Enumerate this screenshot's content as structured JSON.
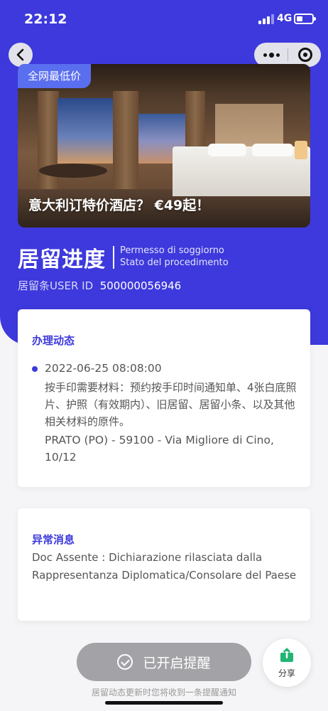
{
  "status_bar": {
    "time": "22:12",
    "network": "4G"
  },
  "nav": {
    "back_icon": "chevron-left-icon",
    "more_icon": "more-dots-icon",
    "close_icon": "target-circle-icon"
  },
  "banner": {
    "tag": "全网最低价",
    "text": "意大利订特价酒店？ €49起！"
  },
  "header": {
    "title": "居留进度",
    "subtitle_it": "Permesso di soggiorno",
    "subtitle_status": "Stato del procedimento",
    "user_id_label": "居留条USER ID",
    "user_id_value": "500000056946"
  },
  "progress_card": {
    "title": "办理动态",
    "events": [
      {
        "datetime": "2022-06-25 08:08:00",
        "description": "按手印需要材料：预约按手印时间通知单、4张白底照片、护照（有效期内）、旧居留、居留小条、以及其他相关材料的原件。",
        "address": "PRATO (PO) - 59100 - Via Migliore di Cino, 10/12"
      }
    ]
  },
  "abnormal_card": {
    "title": "异常消息",
    "message": "Doc Assente : Dichiarazione rilasciata dalla Rappresentanza Diplomatica/Consolare del Paese"
  },
  "footer": {
    "remind_label": "已开启提醒",
    "share_label": "分享",
    "note": "居留动态更新时您将收到一条提醒通知"
  },
  "colors": {
    "primary": "#3d39dc",
    "button_disabled": "#a3a3a7",
    "share_green": "#22b573"
  }
}
